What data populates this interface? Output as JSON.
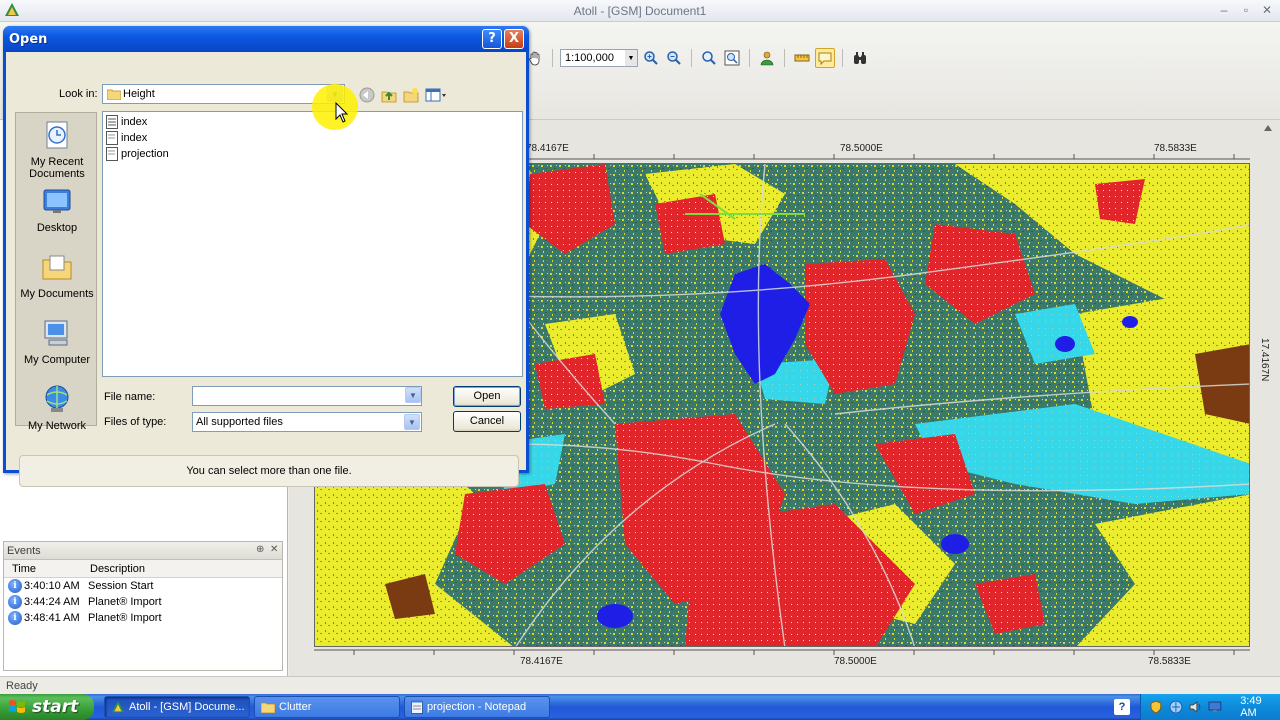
{
  "app": {
    "title": "Atoll - [GSM] Document1",
    "status": "Ready",
    "scale": "1:100,000"
  },
  "map": {
    "top_coords": [
      "78.4167E",
      "78.5000E",
      "78.5833E"
    ],
    "bottom_coords": [
      "78.4167E",
      "78.5000E",
      "78.5833E"
    ],
    "right_coord": "17.4167N"
  },
  "events": {
    "title": "Events",
    "columns": {
      "time": "Time",
      "description": "Description"
    },
    "rows": [
      {
        "time": "3:40:10 AM",
        "description": "Session Start"
      },
      {
        "time": "3:44:24 AM",
        "description": "Planet® Import"
      },
      {
        "time": "3:48:41 AM",
        "description": "Planet® Import"
      }
    ]
  },
  "dialog": {
    "title": "Open",
    "look_in_label": "Look in:",
    "look_in_value": "Height",
    "places": [
      "My Recent Documents",
      "Desktop",
      "My Documents",
      "My Computer",
      "My Network"
    ],
    "files": [
      "index",
      "index",
      "projection"
    ],
    "filename_label": "File name:",
    "filename_value": "",
    "filetype_label": "Files of type:",
    "filetype_value": "All supported files",
    "open_label": "Open",
    "cancel_label": "Cancel",
    "hint": "You can select more than one file.",
    "help_label": "?",
    "close_label": "X"
  },
  "taskbar": {
    "start_label": "start",
    "tasks": [
      "Atoll - [GSM] Docume...",
      "Clutter",
      "projection - Notepad"
    ],
    "clock": "3:49 AM",
    "help": "?"
  },
  "icons": {
    "app_logo": "atoll-logo-icon",
    "folder": "folder-icon",
    "back": "back-icon",
    "up": "up-folder-icon",
    "new_folder": "new-folder-icon",
    "views": "views-menu-icon",
    "info": "info-icon"
  },
  "colors": {
    "xp_blue": "#0a4ed4",
    "start_green": "#379e37",
    "map_red": "#e0262a",
    "map_yellow": "#ecec2e",
    "map_cyan": "#35d7e8",
    "map_teal": "#3b7a6a",
    "map_blue": "#1e1ee6"
  }
}
